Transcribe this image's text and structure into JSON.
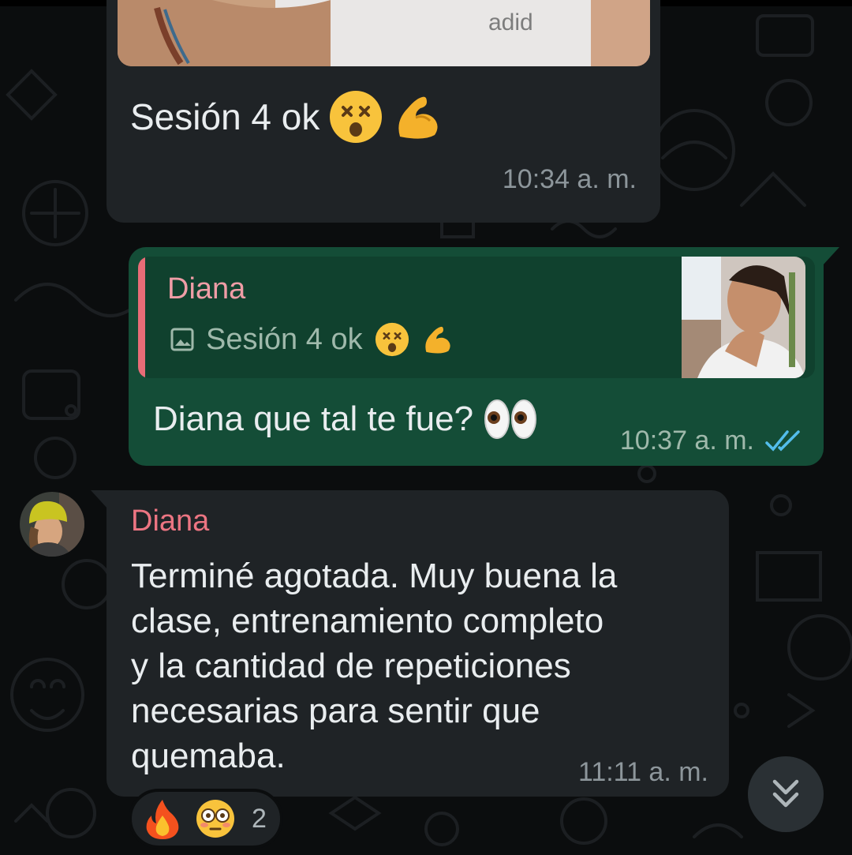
{
  "messages": {
    "first": {
      "caption": "Sesión 4 ok",
      "time": "10:34 a. m.",
      "photo_brand_text": "adid"
    },
    "reply": {
      "quoted_author": "Diana",
      "quoted_caption": "Sesión 4 ok",
      "text": "Diana que tal te fue?",
      "time": "10:37 a. m.",
      "status_icon": "double-check-read-icon"
    },
    "incoming": {
      "sender": "Diana",
      "text": "Terminé agotada. Muy buena la\nclase, entrenamiento completo\ny la cantidad de repeticiones\nnecesarias para sentir que\nquemaba.",
      "time": "11:11 a. m."
    }
  },
  "reactions": {
    "emojis": [
      "fire",
      "flushed-face"
    ],
    "count": "2"
  },
  "colors": {
    "background": "#0b0d0e",
    "incoming_bubble": "#1f2326",
    "outgoing_bubble": "#144d37",
    "sender_name": "#ec7582",
    "read_ticks": "#53bdeb"
  }
}
